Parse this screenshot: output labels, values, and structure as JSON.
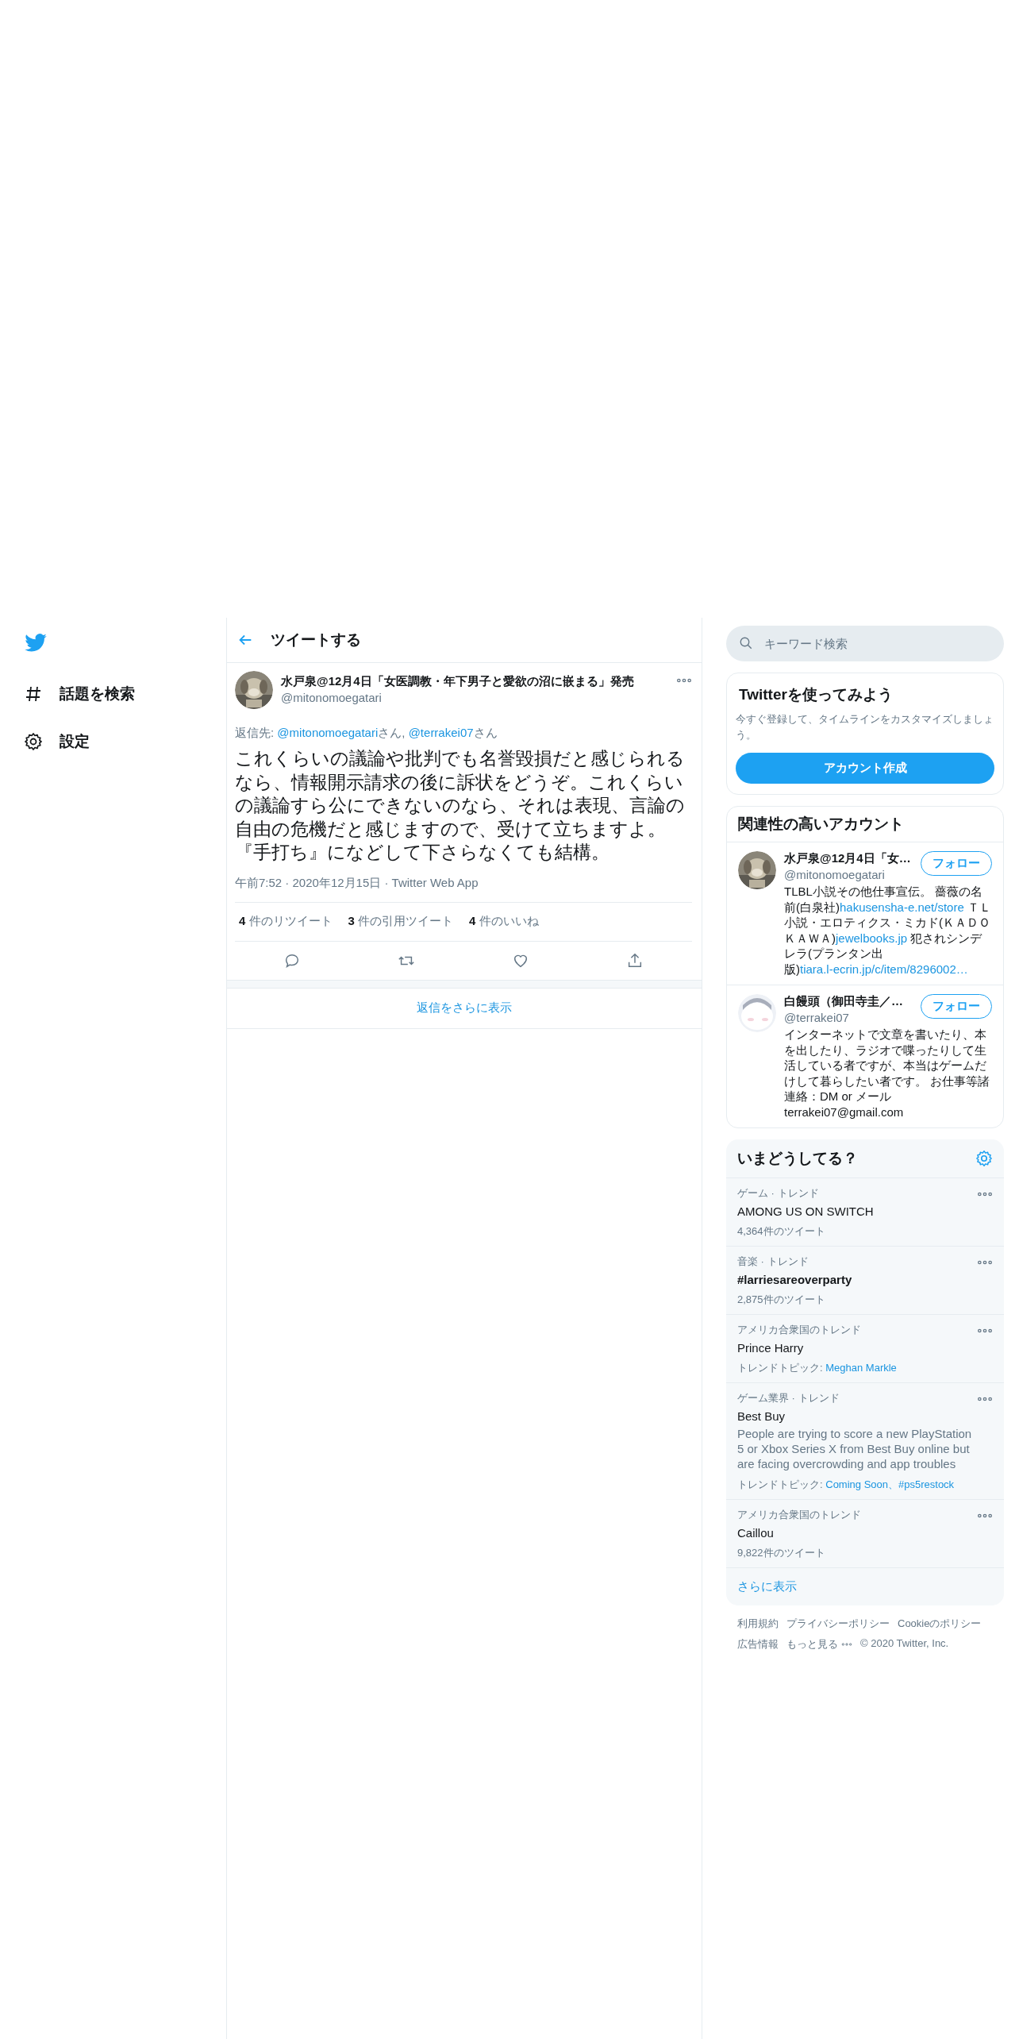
{
  "sidebar": {
    "items": [
      {
        "kind": "hash",
        "label": "話題を検索"
      },
      {
        "kind": "gear",
        "label": "設定"
      }
    ]
  },
  "header": {
    "title": "ツイートする"
  },
  "tweet": {
    "author": {
      "name": "水戸泉@12月4日「女医調教・年下男子と愛欲の沼に嵌まる」発売",
      "handle": "@mitonomoegatari"
    },
    "reply_to": [
      {
        "text": "返信先: ",
        "link": false
      },
      {
        "text": "@mitonomoegatari",
        "link": true
      },
      {
        "text": "さん, ",
        "link": false
      },
      {
        "text": "@terrakei07",
        "link": true
      },
      {
        "text": "さん",
        "link": false
      }
    ],
    "text": "これくらいの議論や批判でも名誉毀損だと感じられるなら、情報開示請求の後に訴状をどうぞ。これくらいの議論すら公にできないのなら、それは表現、言論の自由の危機だと感じますので、受けて立ちますよ。『手打ち』になどして下さらなくても結構。",
    "meta": "午前7:52 · 2020年12月15日 · Twitter Web App",
    "stats": [
      {
        "count": "4",
        "label": "件のリツイート"
      },
      {
        "count": "3",
        "label": "件の引用ツイート"
      },
      {
        "count": "4",
        "label": "件のいいね"
      }
    ],
    "actions": [
      {
        "kind": "reply"
      },
      {
        "kind": "retweet"
      },
      {
        "kind": "like"
      },
      {
        "kind": "share"
      }
    ]
  },
  "show_more_replies": "返信をさらに表示",
  "search": {
    "placeholder": "キーワード検索"
  },
  "signup": {
    "title": "Twitterを使ってみよう",
    "text": "今すぐ登録して、タイムラインをカスタマイズしましょう。",
    "button": "アカウント作成"
  },
  "who_to_follow": {
    "title": "関連性の高いアカウント",
    "accounts": [
      {
        "name": "水戸泉@12月4日「女…",
        "handle": "@mitonomoegatari",
        "button": "フォロー",
        "bio": [
          {
            "text": "TLBL小説その他仕事宣伝。 薔薇の名前(白泉社)",
            "link": false
          },
          {
            "text": "hakusensha-e.net/store",
            "link": true
          },
          {
            "text": " ＴＬ小説・エロティクス・ミカド(ＫＡＤＯＫＡＷＡ)",
            "link": false
          },
          {
            "text": "jewelbooks.jp",
            "link": true
          },
          {
            "text": " 犯されシンデレラ(プランタン出版)",
            "link": false
          },
          {
            "text": "tiara.l-ecrin.jp/c/item/8296002…",
            "link": true
          }
        ]
      },
      {
        "name": "白饅頭（御田寺圭／…",
        "handle": "@terrakei07",
        "button": "フォロー",
        "bio": [
          {
            "text": "インターネットで文章を書いたり、本を出したり、ラジオで喋ったりして生活している者ですが、本当はゲームだけして暮らしたい者です。 お仕事等諸連絡：DM or メール terrakei07@gmail.com",
            "link": false
          }
        ]
      }
    ]
  },
  "trends": {
    "title": "いまどうしてる？",
    "items": [
      {
        "context": "ゲーム · トレンド",
        "name": "AMONG US ON SWITCH",
        "bold": false,
        "count": "4,364件のツイート"
      },
      {
        "context": "音楽 · トレンド",
        "name": "#larriesareoverparty",
        "bold": true,
        "count": "2,875件のツイート"
      },
      {
        "context": "アメリカ合衆国のトレンド",
        "name": "Prince Harry",
        "bold": false,
        "topics_label": "トレンドトピック:",
        "topics": "Meghan Markle"
      },
      {
        "context": "ゲーム業界 · トレンド",
        "name": "Best Buy",
        "bold": false,
        "description": "People are trying to score a new PlayStation 5 or Xbox Series X from Best Buy online but are facing overcrowding and app troubles",
        "topics_label": "トレンドトピック:",
        "topics": "Coming Soon、#ps5restock"
      },
      {
        "context": "アメリカ合衆国のトレンド",
        "name": "Caillou",
        "bold": false,
        "count": "9,822件のツイート"
      }
    ],
    "show_more": "さらに表示"
  },
  "footer": {
    "links": [
      "利用規約",
      "プライバシーポリシー",
      "Cookieのポリシー",
      "広告情報",
      "もっと見る"
    ],
    "copyright": "© 2020 Twitter, Inc."
  }
}
